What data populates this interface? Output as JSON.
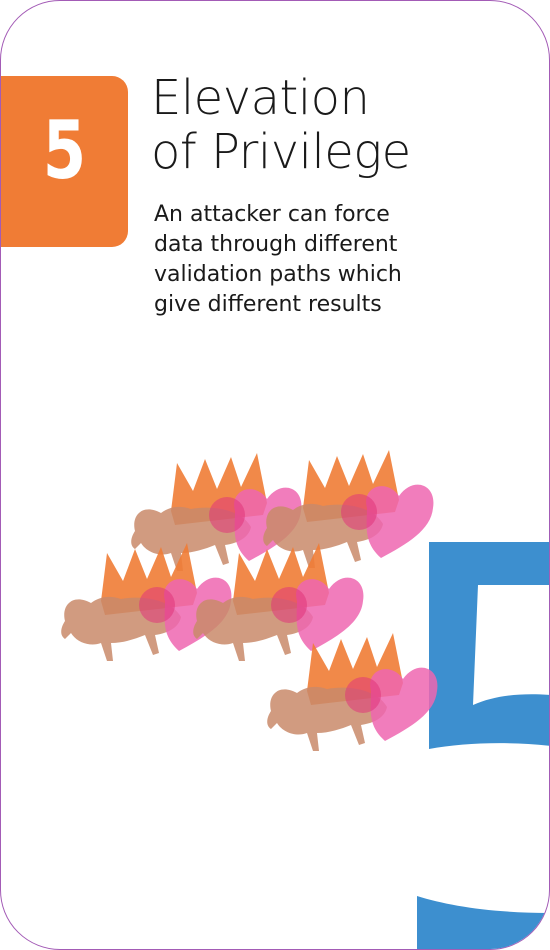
{
  "card": {
    "number": "5",
    "title_lines": [
      "Elevation",
      "of Privilege"
    ],
    "description_lines": [
      "An attacker can force",
      "data through different",
      "validation paths which",
      "give different results"
    ],
    "watermark_number": "5"
  },
  "illustration": {
    "icon": "crowned-bison-heart-icon",
    "count": 5
  },
  "colors": {
    "badge": "#f07c35",
    "watermark": "#3d8fcf",
    "border": "#a35bb6",
    "crown": "#f07c35",
    "bison": "#c98a6a",
    "heart": "#ee66b0"
  }
}
